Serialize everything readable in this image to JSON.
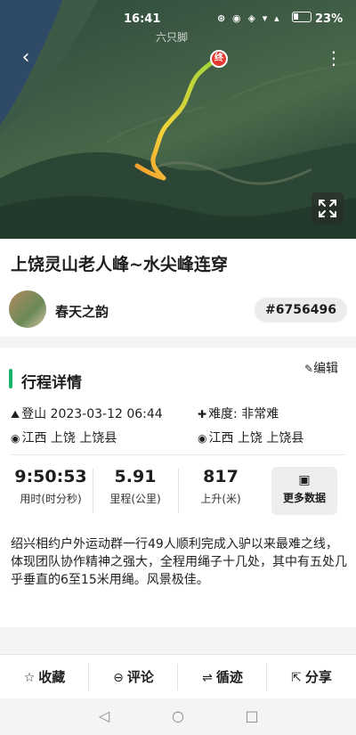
{
  "status_bar": {
    "time": "16:41",
    "icons": "⊛ ◉ ◈ ▾ ▴",
    "battery_pct": "23%"
  },
  "map": {
    "place_label": "六只脚",
    "end_marker": "终",
    "colors": {
      "route_start": "#f29a2e",
      "route_end": "#9bd63a",
      "end_marker": "#e63a30"
    }
  },
  "header": {
    "title": "上饶灵山老人峰~水尖峰连穿",
    "author": "春天之韵",
    "track_id": "#6756496"
  },
  "details": {
    "section_title": "行程详情",
    "edit_label": "编辑",
    "activity": "登山 2023-03-12 06:44",
    "difficulty": "难度:  非常难",
    "start_location": "江西 上饶 上饶县",
    "end_location": "江西 上饶 上饶县",
    "stats": [
      {
        "value": "9:50:53",
        "label": "用时(时分秒)"
      },
      {
        "value": "5.91",
        "label": "里程(公里)"
      },
      {
        "value": "817",
        "label": "上升(米)"
      }
    ],
    "more_data_label": "更多数据",
    "description": "绍兴相约户外运动群一行49人顺利完成入驴以来最难之线，体现团队协作精神之强大，全程用绳子十几处，其中有五处几乎垂直的6至15米用绳。风景极佳。",
    "accent_color": "#19b36b"
  },
  "actions": [
    {
      "icon": "☆",
      "label": "收藏"
    },
    {
      "icon": "⊖",
      "label": "评论"
    },
    {
      "icon": "⇌",
      "label": "循迹"
    },
    {
      "icon": "⇱",
      "label": "分享"
    }
  ],
  "nav": {
    "back": "◁",
    "home": "○",
    "recent": "□"
  }
}
